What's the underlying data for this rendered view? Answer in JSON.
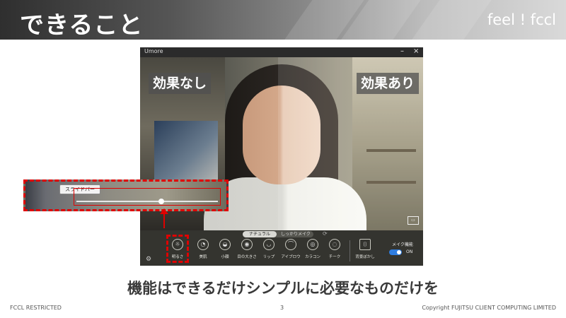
{
  "slide": {
    "title": "できること",
    "brand": "feel ! fccl",
    "caption": "機能はできるだけシンプルに必要なものだけを",
    "footer_left": "FCCL RESTRICTED",
    "page_number": "3",
    "footer_right": "Copyright FUJITSU CLIENT COMPUTING LIMITED",
    "highlight_color": "#e00000"
  },
  "app": {
    "name": "Umore",
    "minimize": "–",
    "close": "×",
    "label_no_effect": "効果なし",
    "label_effect": "効果あり",
    "modes": {
      "active": "ナチュラル",
      "other": "しっかりメイク"
    },
    "tools": [
      {
        "icon": "brightness-icon",
        "label": "明るさ"
      },
      {
        "icon": "skin-icon",
        "label": "美肌"
      },
      {
        "icon": "small-face-icon",
        "label": "小顔"
      },
      {
        "icon": "eye-size-icon",
        "label": "目の大きさ"
      },
      {
        "icon": "lip-icon",
        "label": "リップ"
      },
      {
        "icon": "eyebrow-icon",
        "label": "アイブロウ"
      },
      {
        "icon": "color-contact-icon",
        "label": "カラコン"
      },
      {
        "icon": "cheek-icon",
        "label": "チーク"
      },
      {
        "icon": "background-blur-icon",
        "label": "背景ぼかし"
      }
    ],
    "makeup_label": "メイク機能",
    "makeup_state": "ON",
    "makeup_on": true
  },
  "slider": {
    "label": "スライドバー",
    "value_fraction": 0.6
  }
}
